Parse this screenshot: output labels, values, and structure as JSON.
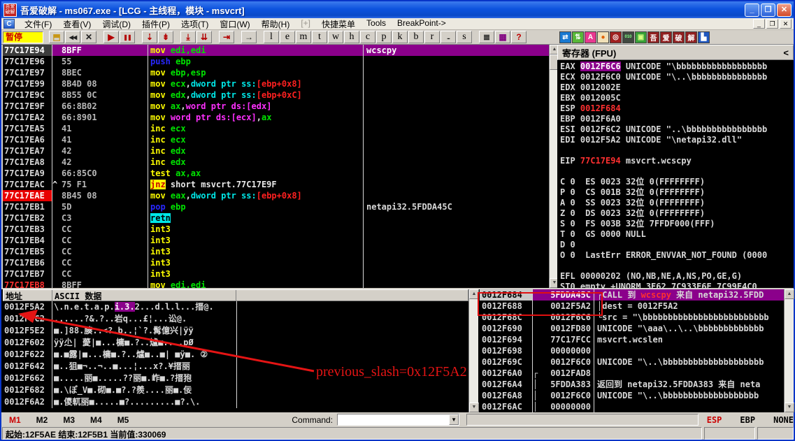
{
  "window": {
    "title": "吾爱破解 - ms067.exe - [LCG -  主线程，模块 - msvcrt]",
    "logo": "吾爱破解",
    "mdi_icon": "C",
    "controls": {
      "minimize": "_",
      "maximize": "❐",
      "close": "✕"
    }
  },
  "menu": {
    "items": [
      {
        "label": "文件(F)"
      },
      {
        "label": "查看(V)"
      },
      {
        "label": "调试(D)"
      },
      {
        "label": "插件(P)"
      },
      {
        "label": "选项(T)"
      },
      {
        "label": "窗口(W)"
      },
      {
        "label": "帮助(H)"
      },
      {
        "label": "[+]",
        "dim": true
      },
      {
        "label": "快捷菜单"
      },
      {
        "label": "Tools"
      },
      {
        "label": "BreakPoint->"
      }
    ]
  },
  "toolbar": {
    "status_text": "暂停",
    "buttons": [
      {
        "name": "open-file-button",
        "glyph": "⬒",
        "fg": "#C89818"
      },
      {
        "name": "rewind-button",
        "glyph": "◀◀",
        "fg": "#202020",
        "small": true
      },
      {
        "name": "close-window-button",
        "glyph": "✕",
        "fg": "#202020"
      },
      {
        "name": "run-button",
        "glyph": "▶",
        "fg": "#B40000",
        "gap": true
      },
      {
        "name": "pause-button",
        "glyph": "❚❚",
        "fg": "#B40000",
        "small": true
      },
      {
        "name": "step-into-button",
        "glyph": "⇣",
        "fg": "#B40000",
        "gap": true
      },
      {
        "name": "step-over-button",
        "glyph": "⇟",
        "fg": "#B40000"
      },
      {
        "name": "trace-into-button",
        "glyph": "⤓",
        "fg": "#B40000",
        "gap": true
      },
      {
        "name": "trace-over-button",
        "glyph": "⇊",
        "fg": "#B40000"
      },
      {
        "name": "execute-till-return-button",
        "glyph": "⇥",
        "fg": "#B40000",
        "gap": true
      },
      {
        "name": "go-to-button",
        "glyph": "→",
        "fg": "#202020",
        "gap": true
      },
      {
        "name": "log-button",
        "glyph": "l",
        "serif": true,
        "gap": true
      },
      {
        "name": "executables-button",
        "glyph": "e",
        "serif": true
      },
      {
        "name": "memory-button",
        "glyph": "m",
        "serif": true
      },
      {
        "name": "threads-button",
        "glyph": "t",
        "serif": true
      },
      {
        "name": "windows-list-button",
        "glyph": "w",
        "serif": true
      },
      {
        "name": "handles-button",
        "glyph": "h",
        "serif": true
      },
      {
        "name": "cpu-button",
        "glyph": "c",
        "serif": true
      },
      {
        "name": "patches-button",
        "glyph": "p",
        "serif": true
      },
      {
        "name": "call-stack-button",
        "glyph": "k",
        "serif": true
      },
      {
        "name": "breakpoints-button",
        "glyph": "b",
        "serif": true
      },
      {
        "name": "references-button",
        "glyph": "r",
        "serif": true
      },
      {
        "name": "run-trace-button",
        "glyph": "...",
        "small": true
      },
      {
        "name": "source-button",
        "glyph": "s",
        "serif": true
      },
      {
        "name": "breakpoint-list-button",
        "glyph": "≣",
        "fg": "#202020",
        "gap": true
      },
      {
        "name": "windows-k-button",
        "glyph": "▦",
        "fg": "#800080"
      },
      {
        "name": "help-button",
        "glyph": "?",
        "fg": "#C00000"
      }
    ],
    "plugins": [
      {
        "name": "swap-plugin-button",
        "glyph": "⇄",
        "bg": "#1878D0",
        "fg": "#FFFFFF",
        "gap": true
      },
      {
        "name": "updown-plugin-button",
        "glyph": "⇅",
        "bg": "#58B838",
        "fg": "#FFFFFF"
      },
      {
        "name": "assembler-plugin-button",
        "glyph": "A",
        "bg": "#E83890",
        "fg": "#FFFFFF"
      },
      {
        "name": "record-plugin-button",
        "glyph": "●",
        "bg": "#F0E0B8",
        "fg": "#E06000"
      },
      {
        "name": "target-plugin-button",
        "glyph": "◎",
        "bg": "#A02020",
        "fg": "#FFFFFF"
      },
      {
        "name": "binary-plugin-button",
        "glyph": "010",
        "bg": "#404840",
        "fg": "#80FF80",
        "tiny": true
      },
      {
        "name": "window-plugin-button",
        "glyph": "▣",
        "bg": "#38A038",
        "fg": "#D8FF80"
      },
      {
        "name": "52pojie-wu-button",
        "glyph": "吾",
        "bg": "#902020",
        "fg": "#FFFFFF"
      },
      {
        "name": "52pojie-ai-button",
        "glyph": "爱",
        "bg": "#902020",
        "fg": "#FFFFFF"
      },
      {
        "name": "52pojie-po-button",
        "glyph": "破",
        "bg": "#902020",
        "fg": "#FFFFFF"
      },
      {
        "name": "52pojie-jie-button",
        "glyph": "解",
        "bg": "#902020",
        "fg": "#FFFFFF"
      },
      {
        "name": "extra-plugin-button",
        "glyph": "▙",
        "bg": "#2058C0",
        "fg": "#FFFFFF"
      }
    ]
  },
  "disasm": {
    "rows": [
      {
        "addr": "77C17E94",
        "bytes": "8BFF",
        "ins": [
          [
            "mov ",
            "op"
          ],
          [
            "edi,edi",
            "reg"
          ]
        ],
        "comment": "wcscpy",
        "style": "sel"
      },
      {
        "addr": "77C17E96",
        "bytes": "55",
        "ins": [
          [
            "push ",
            "kw"
          ],
          [
            "ebp",
            "reg"
          ]
        ]
      },
      {
        "addr": "77C17E97",
        "bytes": "8BEC",
        "ins": [
          [
            "mov ",
            "op"
          ],
          [
            "ebp,esp",
            "reg"
          ]
        ]
      },
      {
        "addr": "77C17E99",
        "bytes": "8B4D 08",
        "ins": [
          [
            "mov ",
            "op"
          ],
          [
            "ecx",
            "reg"
          ],
          [
            ",",
            "pl"
          ],
          [
            "dword ptr ss:",
            "cy"
          ],
          [
            "[ebp+0x8]",
            "rd"
          ]
        ]
      },
      {
        "addr": "77C17E9C",
        "bytes": "8B55 0C",
        "ins": [
          [
            "mov ",
            "op"
          ],
          [
            "edx",
            "reg"
          ],
          [
            ",",
            "pl"
          ],
          [
            "dword ptr ss:",
            "cy"
          ],
          [
            "[ebp+0xC]",
            "rd"
          ]
        ]
      },
      {
        "addr": "77C17E9F",
        "bytes": "66:8B02",
        "ins": [
          [
            "mov ",
            "op"
          ],
          [
            "ax",
            "reg"
          ],
          [
            ",",
            "pl"
          ],
          [
            "word ptr ds:[edx]",
            "mg"
          ]
        ]
      },
      {
        "addr": "77C17EA2",
        "bytes": "66:8901",
        "ins": [
          [
            "mov ",
            "op"
          ],
          [
            "word ptr ds:[ecx]",
            "mg"
          ],
          [
            ",",
            "pl"
          ],
          [
            "ax",
            "reg"
          ]
        ]
      },
      {
        "addr": "77C17EA5",
        "bytes": "41",
        "ins": [
          [
            "inc ",
            "op"
          ],
          [
            "ecx",
            "reg"
          ]
        ]
      },
      {
        "addr": "77C17EA6",
        "bytes": "41",
        "ins": [
          [
            "inc ",
            "op"
          ],
          [
            "ecx",
            "reg"
          ]
        ]
      },
      {
        "addr": "77C17EA7",
        "bytes": "42",
        "ins": [
          [
            "inc ",
            "op"
          ],
          [
            "edx",
            "reg"
          ]
        ]
      },
      {
        "addr": "77C17EA8",
        "bytes": "42",
        "ins": [
          [
            "inc ",
            "op"
          ],
          [
            "edx",
            "reg"
          ]
        ]
      },
      {
        "addr": "77C17EA9",
        "bytes": "66:85C0",
        "ins": [
          [
            "test ",
            "op"
          ],
          [
            "ax,ax",
            "reg"
          ]
        ]
      },
      {
        "addr": "77C17EAC",
        "mark": "^",
        "bytes": "75 F1",
        "ins": [
          [
            "jnz",
            "jz"
          ],
          [
            " short msvcrt.77C17E9F",
            "pl"
          ]
        ]
      },
      {
        "addr": "77C17EAE",
        "bytes": "8B45 08",
        "ins": [
          [
            "mov ",
            "op"
          ],
          [
            "eax",
            "reg"
          ],
          [
            ",",
            "pl"
          ],
          [
            "dword ptr ss:",
            "cy"
          ],
          [
            "[ebp+0x8]",
            "rd"
          ]
        ],
        "style": "bp"
      },
      {
        "addr": "77C17EB1",
        "bytes": "5D",
        "ins": [
          [
            "pop ",
            "kw"
          ],
          [
            "ebp",
            "reg"
          ]
        ],
        "comment": "netapi32.5FDDA45C"
      },
      {
        "addr": "77C17EB2",
        "bytes": "C3",
        "ins": [
          [
            "retn",
            "rt"
          ]
        ]
      },
      {
        "addr": "77C17EB3",
        "bytes": "CC",
        "ins": [
          [
            "int3",
            "op"
          ]
        ]
      },
      {
        "addr": "77C17EB4",
        "bytes": "CC",
        "ins": [
          [
            "int3",
            "op"
          ]
        ]
      },
      {
        "addr": "77C17EB5",
        "bytes": "CC",
        "ins": [
          [
            "int3",
            "op"
          ]
        ]
      },
      {
        "addr": "77C17EB6",
        "bytes": "CC",
        "ins": [
          [
            "int3",
            "op"
          ]
        ]
      },
      {
        "addr": "77C17EB7",
        "bytes": "CC",
        "ins": [
          [
            "int3",
            "op"
          ]
        ]
      },
      {
        "addr": "77C17EB8",
        "bytes": "8BFF",
        "ins": [
          [
            "mov ",
            "op"
          ],
          [
            "edi,edi",
            "reg"
          ]
        ],
        "style": "next"
      }
    ]
  },
  "registers": {
    "title": "寄存器 (FPU)",
    "collapse_glyph": "<",
    "lines": [
      [
        [
          "EAX ",
          "w"
        ],
        [
          "0012F6C6",
          "hl"
        ],
        [
          " UNICODE \"\\bbbbbbbbbbbbbbbbbb",
          "w"
        ]
      ],
      [
        [
          "ECX 0012F6C0 UNICODE \"\\..\\bbbbbbbbbbbbbbb",
          "w"
        ]
      ],
      [
        [
          "EDX 0012002E",
          "w"
        ]
      ],
      [
        [
          "EBX 0012005C",
          "w"
        ]
      ],
      [
        [
          "ESP ",
          "w"
        ],
        [
          "0012F684",
          "r"
        ]
      ],
      [
        [
          "EBP 0012F6A0",
          "w"
        ]
      ],
      [
        [
          "ESI 0012F6C2 UNICODE \"..\\bbbbbbbbbbbbbbbb",
          "w"
        ]
      ],
      [
        [
          "EDI 0012F5A2 UNICODE \"\\netapi32.dll\"",
          "w"
        ]
      ],
      [],
      [
        [
          "EIP ",
          "w"
        ],
        [
          "77C17E94",
          "r"
        ],
        [
          " msvcrt.wcscpy",
          "w"
        ]
      ],
      [],
      [
        [
          "C 0  ES 0023 32位 0(FFFFFFFF)",
          "w"
        ]
      ],
      [
        [
          "P 0  CS 001B 32位 0(FFFFFFFF)",
          "w"
        ]
      ],
      [
        [
          "A 0  SS 0023 32位 0(FFFFFFFF)",
          "w"
        ]
      ],
      [
        [
          "Z 0  DS 0023 32位 0(FFFFFFFF)",
          "w"
        ]
      ],
      [
        [
          "S 0  FS 003B 32位 7FFDF000(FFF)",
          "w"
        ]
      ],
      [
        [
          "T 0  GS 0000 NULL",
          "w"
        ]
      ],
      [
        [
          "D 0",
          "w"
        ]
      ],
      [
        [
          "O 0  LastErr ERROR_ENVVAR_NOT_FOUND (0000",
          "w"
        ]
      ],
      [],
      [
        [
          "EFL 00000202 (NO,NB,NE,A,NS,PO,GE,G)",
          "w"
        ]
      ],
      [
        [
          "ST0 empty +UNORM 3E62 7C933E6E 7C99E4C0",
          "w"
        ]
      ]
    ]
  },
  "dump": {
    "headers": {
      "addr": "地址",
      "data": "ASCII 数据"
    },
    "rows": [
      {
        "addr": "0012F5A2",
        "segs": [
          [
            "\\.n.e.t.a.p.",
            "w"
          ],
          [
            "i.3.",
            "hl"
          ],
          [
            "2...d.l.l...搢@.",
            "w"
          ]
        ]
      },
      {
        "addr": "0012F5C2",
        "segs": [
          [
            "......?&.?..岩q...£¦...讼@.",
            "w"
          ]
        ]
      },
      {
        "addr": "0012F5E2",
        "segs": [
          [
            "■.]88.腠..<?.b..¦`?.髯億兴|ÿÿ",
            "w"
          ]
        ]
      },
      {
        "addr": "0012F602",
        "segs": [
          [
            "ÿÿ尐| 薆|■...槦■.?..爐■....pØ",
            "w"
          ]
        ]
      },
      {
        "addr": "0012F622",
        "segs": [
          [
            "■.■露|■...槦■.?..爐■..■| ■ÿ■. ②",
            "w"
          ]
        ]
      },
      {
        "addr": "0012F642",
        "segs": [
          [
            "■..狙■¬..¬..■...¦...x?.¥搢丽",
            "w"
          ]
        ]
      },
      {
        "addr": "0012F662",
        "segs": [
          [
            "■.....丽■.....??丽■.岞■.?搢狍",
            "w"
          ]
        ]
      },
      {
        "addr": "0012F682",
        "segs": [
          [
            "■.\\ぽ_V■.砌■.■?.?羨....丽■.佞",
            "w"
          ]
        ]
      },
      {
        "addr": "0012F6A2",
        "segs": [
          [
            "■.儍軏丽■.....■?.........■?.\\.",
            "w"
          ]
        ]
      }
    ]
  },
  "stack": {
    "rows": [
      {
        "addr": "0012F684",
        "value": "5FDDA45C",
        "style": "hl",
        "segs": [
          [
            "┌CALL 到 ",
            "w"
          ],
          [
            "wcscpy",
            "r"
          ],
          [
            " 来自 netapi32.5FDD",
            "w"
          ]
        ]
      },
      {
        "addr": "0012F688",
        "value": "0012F5A2",
        "segs": [
          [
            "│dest = 0012F5A2",
            "w"
          ]
        ]
      },
      {
        "addr": "0012F68C",
        "value": "0012F6C6",
        "segs": [
          [
            "└src = \"\\bbbbbbbbbbbbbbbbbbbbbbbbb",
            "w"
          ]
        ]
      },
      {
        "addr": "0012F690",
        "value": "0012FD80",
        "segs": [
          [
            "UNICODE \"\\aaa\\..\\..\\bbbbbbbbbbbbb",
            "w"
          ]
        ]
      },
      {
        "addr": "0012F694",
        "value": "77C17FCC",
        "segs": [
          [
            "msvcrt.wcslen",
            "w"
          ]
        ]
      },
      {
        "addr": "0012F698",
        "value": "00000000",
        "segs": []
      },
      {
        "addr": "0012F69C",
        "value": "0012F6C0",
        "segs": [
          [
            "UNICODE \"\\..\\bbbbbbbbbbbbbbbbbbbb",
            "w"
          ]
        ]
      },
      {
        "addr": "0012F6A0",
        "vp": "┌",
        "value": "0012FAD8",
        "segs": []
      },
      {
        "addr": "0012F6A4",
        "vp": "│",
        "value": "5FDDA383",
        "segs": [
          [
            "返回到 netapi32.5FDDA383 来自 neta",
            "w"
          ]
        ]
      },
      {
        "addr": "0012F6A8",
        "vp": "│",
        "value": "0012F6C0",
        "segs": [
          [
            "UNICODE \"\\..\\bbbbbbbbbbbbbbbbbbb",
            "w"
          ]
        ]
      },
      {
        "addr": "0012F6AC",
        "vp": "│",
        "value": "00000000",
        "segs": []
      }
    ]
  },
  "annotation": {
    "text": "previous_slash=0x12F5A2"
  },
  "tabs": [
    {
      "label": "M1",
      "active": true
    },
    {
      "label": "M2"
    },
    {
      "label": "M3"
    },
    {
      "label": "M4"
    },
    {
      "label": "M5"
    }
  ],
  "command": {
    "label": "Command:",
    "value": "",
    "dropdown_glyph": "▼"
  },
  "bottom_right": [
    {
      "label": "ESP",
      "red": true
    },
    {
      "label": "EBP"
    },
    {
      "label": "NONE"
    }
  ],
  "statusbar": {
    "text": "起始:12F5AE 结束:12F5B1 当前值:330069"
  }
}
